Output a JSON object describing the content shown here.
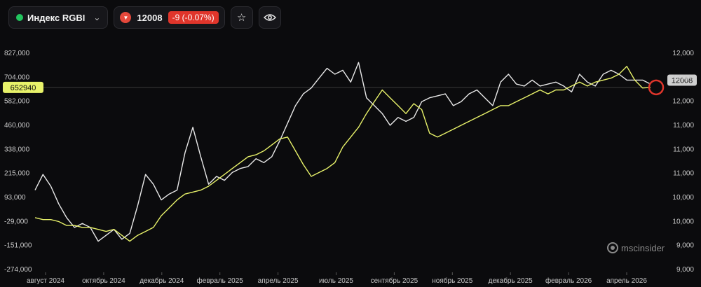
{
  "toolbar": {
    "index_name": "Индекс RGBI",
    "price": "12008",
    "change": "-9 (-0.07%)",
    "status_color": "#22c55e",
    "change_color": "#e0352b"
  },
  "markers": {
    "left_value": "652940",
    "right_value": "12008"
  },
  "watermark": "mscinsider",
  "chart_data": {
    "type": "line",
    "x_ticks": [
      "август 2024",
      "октябрь 2024",
      "декабрь 2024",
      "февраль 2025",
      "апрель 2025",
      "июль 2025",
      "сентябрь 2025",
      "ноябрь 2025",
      "декабрь 2025",
      "февраль 2026",
      "апрель 2026"
    ],
    "left_axis": {
      "ticks": [
        "827,000",
        "704,000",
        "582,000",
        "460,000",
        "338,000",
        "215,000",
        "93,000",
        "-29,000",
        "-151,000",
        "-274,000"
      ],
      "min": -274000,
      "max": 827000
    },
    "right_axis": {
      "ticks": [
        "12,000",
        "12,000",
        "12,000",
        "11,000",
        "11,000",
        "11,000",
        "10,000",
        "10,000",
        "9,000",
        "9,000"
      ]
    },
    "series": [
      {
        "color": "#e8e8e8",
        "axis": "left",
        "values": [
          130000,
          210000,
          150000,
          60000,
          -10000,
          -60000,
          -40000,
          -60000,
          -130000,
          -100000,
          -70000,
          -120000,
          -90000,
          50000,
          210000,
          160000,
          80000,
          110000,
          130000,
          320000,
          450000,
          300000,
          160000,
          200000,
          180000,
          220000,
          240000,
          250000,
          290000,
          270000,
          300000,
          380000,
          470000,
          560000,
          620000,
          650000,
          700000,
          750000,
          720000,
          740000,
          680000,
          780000,
          600000,
          560000,
          520000,
          460000,
          500000,
          480000,
          500000,
          580000,
          600000,
          610000,
          620000,
          560000,
          580000,
          620000,
          640000,
          600000,
          560000,
          680000,
          720000,
          670000,
          660000,
          690000,
          660000,
          670000,
          680000,
          660000,
          630000,
          720000,
          680000,
          660000,
          720000,
          740000,
          720000,
          690000,
          690000,
          690000,
          670000
        ]
      },
      {
        "color": "#e8f26a",
        "axis": "left",
        "values": [
          -10000,
          -20000,
          -20000,
          -30000,
          -50000,
          -50000,
          -60000,
          -60000,
          -70000,
          -80000,
          -70000,
          -100000,
          -130000,
          -100000,
          -80000,
          -60000,
          0,
          40000,
          80000,
          110000,
          120000,
          130000,
          150000,
          180000,
          210000,
          240000,
          270000,
          300000,
          310000,
          330000,
          360000,
          390000,
          400000,
          330000,
          260000,
          200000,
          220000,
          240000,
          270000,
          350000,
          400000,
          450000,
          520000,
          580000,
          640000,
          600000,
          560000,
          520000,
          570000,
          540000,
          420000,
          400000,
          420000,
          440000,
          460000,
          480000,
          500000,
          520000,
          540000,
          560000,
          560000,
          580000,
          600000,
          620000,
          640000,
          620000,
          640000,
          640000,
          660000,
          680000,
          660000,
          680000,
          690000,
          700000,
          720000,
          760000,
          690000,
          650000,
          652940
        ]
      }
    ]
  }
}
